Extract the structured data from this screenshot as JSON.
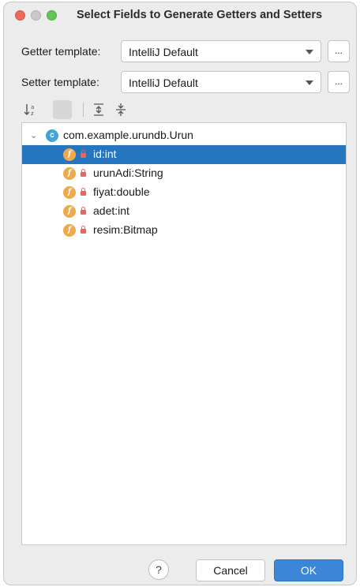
{
  "window": {
    "title": "Select Fields to Generate Getters and Setters"
  },
  "getter": {
    "label": "Getter template:",
    "value": "IntelliJ Default",
    "more_label": "..."
  },
  "setter": {
    "label": "Setter template:",
    "value": "IntelliJ Default",
    "more_label": "..."
  },
  "toolbar": {
    "icons": [
      "sort-alphabetically-icon",
      "show-classes-icon",
      "expand-all-icon",
      "collapse-all-icon"
    ]
  },
  "tree": {
    "class_icon_letter": "c",
    "class_name": "com.example.urundb.Urun",
    "field_icon_letter": "f",
    "fields": [
      {
        "label": "id:int",
        "selected": true
      },
      {
        "label": "urunAdi:String",
        "selected": false
      },
      {
        "label": "fiyat:double",
        "selected": false
      },
      {
        "label": "adet:int",
        "selected": false
      },
      {
        "label": "resim:Bitmap",
        "selected": false
      }
    ]
  },
  "buttons": {
    "help_label": "?",
    "cancel_label": "Cancel",
    "ok_label": "OK"
  },
  "colors": {
    "selection": "#2675bf",
    "ok_button": "#3b86d6",
    "field_icon": "#f0a94a",
    "class_icon": "#42a5d6",
    "lock": "#d96a6a"
  }
}
